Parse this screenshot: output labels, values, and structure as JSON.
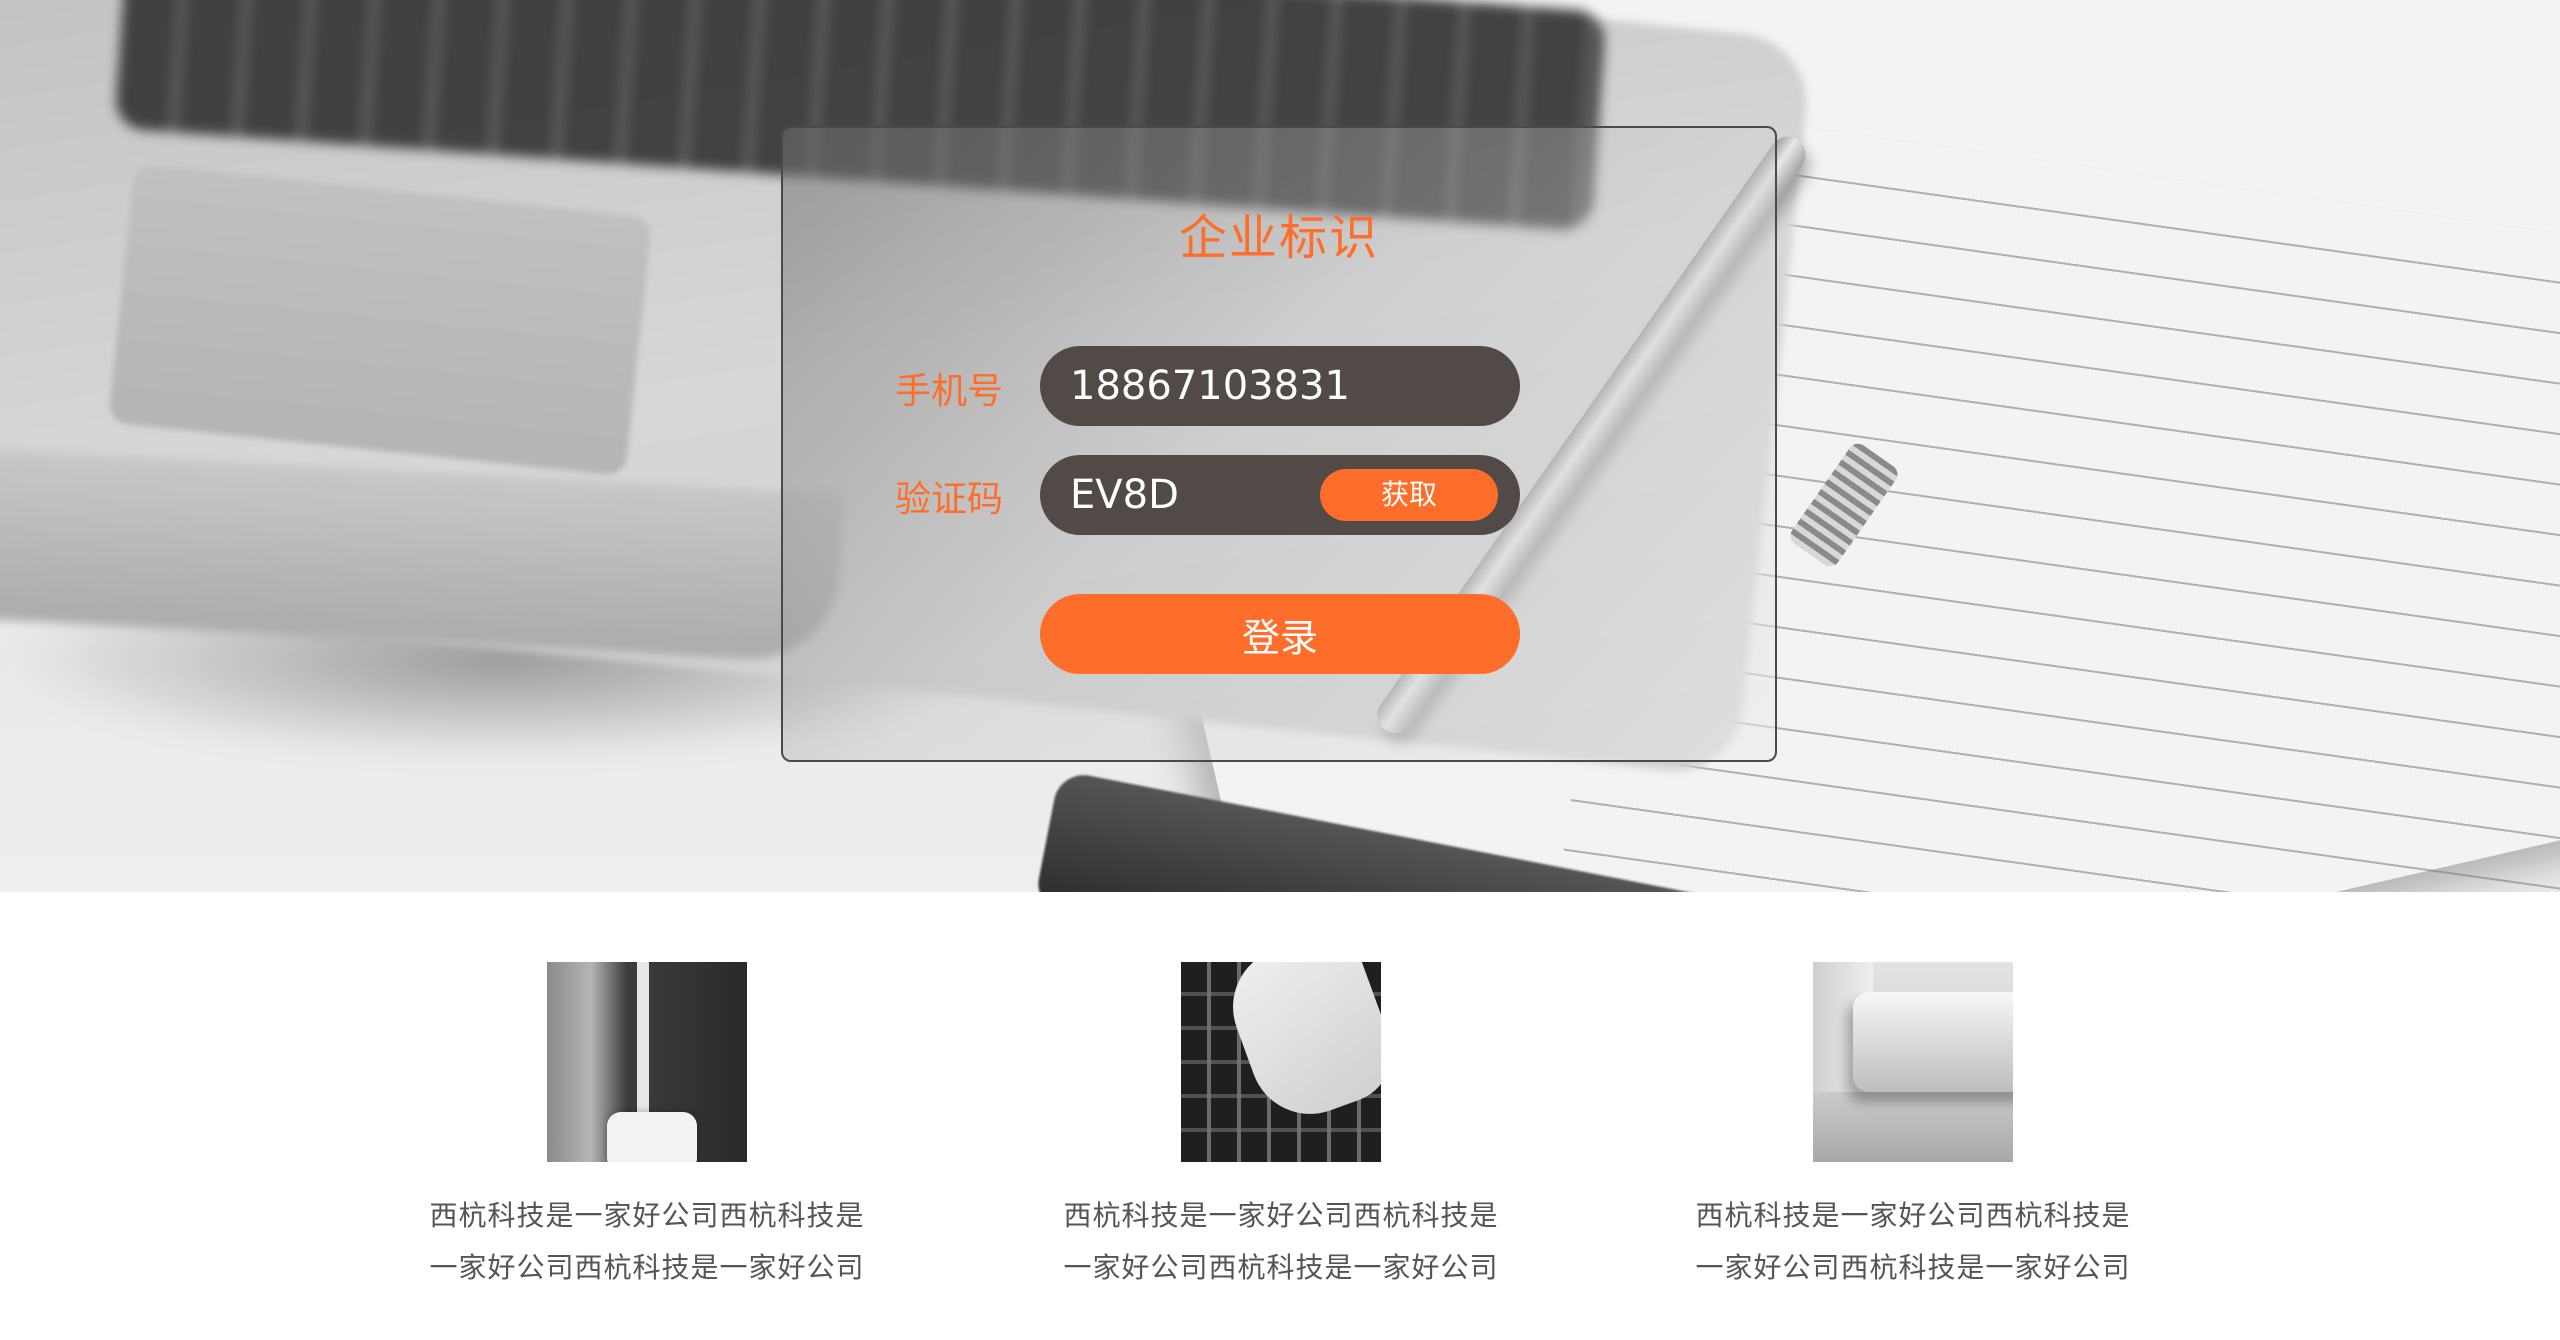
{
  "login": {
    "title": "企业标识",
    "phone_label": "手机号",
    "phone_value": "18867103831",
    "code_label": "验证码",
    "code_value": "EV8D",
    "get_code_label": "获取",
    "submit_label": "登录"
  },
  "features": [
    {
      "thumb": "phone-cable-photo",
      "line1": "西杭科技是一家好公司西杭科技是",
      "line2": "一家好公司西杭科技是一家好公司"
    },
    {
      "thumb": "keyboard-hand-photo",
      "line1": "西杭科技是一家好公司西杭科技是",
      "line2": "一家好公司西杭科技是一家好公司"
    },
    {
      "thumb": "laptop-corner-photo",
      "line1": "西杭科技是一家好公司西杭科技是",
      "line2": "一家好公司西杭科技是一家好公司"
    }
  ],
  "colors": {
    "accent": "#ff6d2b",
    "input_background": "#514a47",
    "body_text": "#555555"
  }
}
